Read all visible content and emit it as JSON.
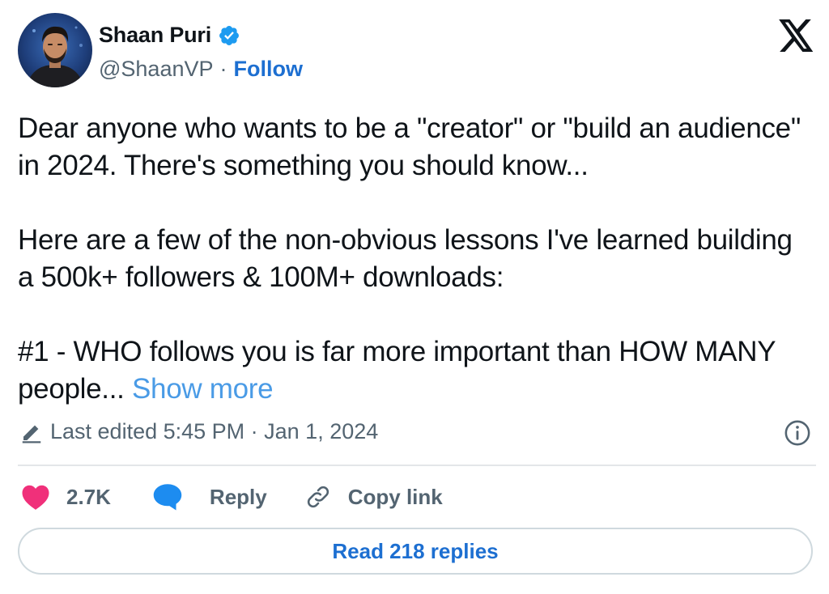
{
  "author": {
    "display_name": "Shaan Puri",
    "handle": "@ShaanVP",
    "separator": "·",
    "follow_label": "Follow",
    "verified": true
  },
  "platform_icon": "x-logo-icon",
  "tweet": {
    "paragraphs": [
      "Dear anyone who wants to be a \"creator\" or \"build an audience\" in 2024. There's something you should know...",
      "Here are a few of the non-obvious lessons I've learned building a 500k+ followers & 100M+ downloads:",
      "#1 - WHO follows you is far more important than HOW MANY people..."
    ],
    "show_more_label": "Show more"
  },
  "edited": {
    "icon": "pencil-icon",
    "text": "Last edited 5:45 PM · Jan 1, 2024",
    "info_icon": "info-icon"
  },
  "actions": {
    "like": {
      "icon": "heart-icon",
      "count": "2.7K"
    },
    "reply": {
      "icon": "speech-bubble-icon",
      "label": "Reply"
    },
    "copy_link": {
      "icon": "link-icon",
      "label": "Copy link"
    }
  },
  "read_replies_label": "Read 218 replies",
  "colors": {
    "text": "#0f1419",
    "secondary": "#536471",
    "link_blue": "#1d6fd1",
    "show_more_blue": "#4a9be6",
    "verified_blue": "#1d9bf0",
    "heart_pink": "#f0307a",
    "reply_blue": "#1d8cf0",
    "divider": "#e3e6e9"
  }
}
